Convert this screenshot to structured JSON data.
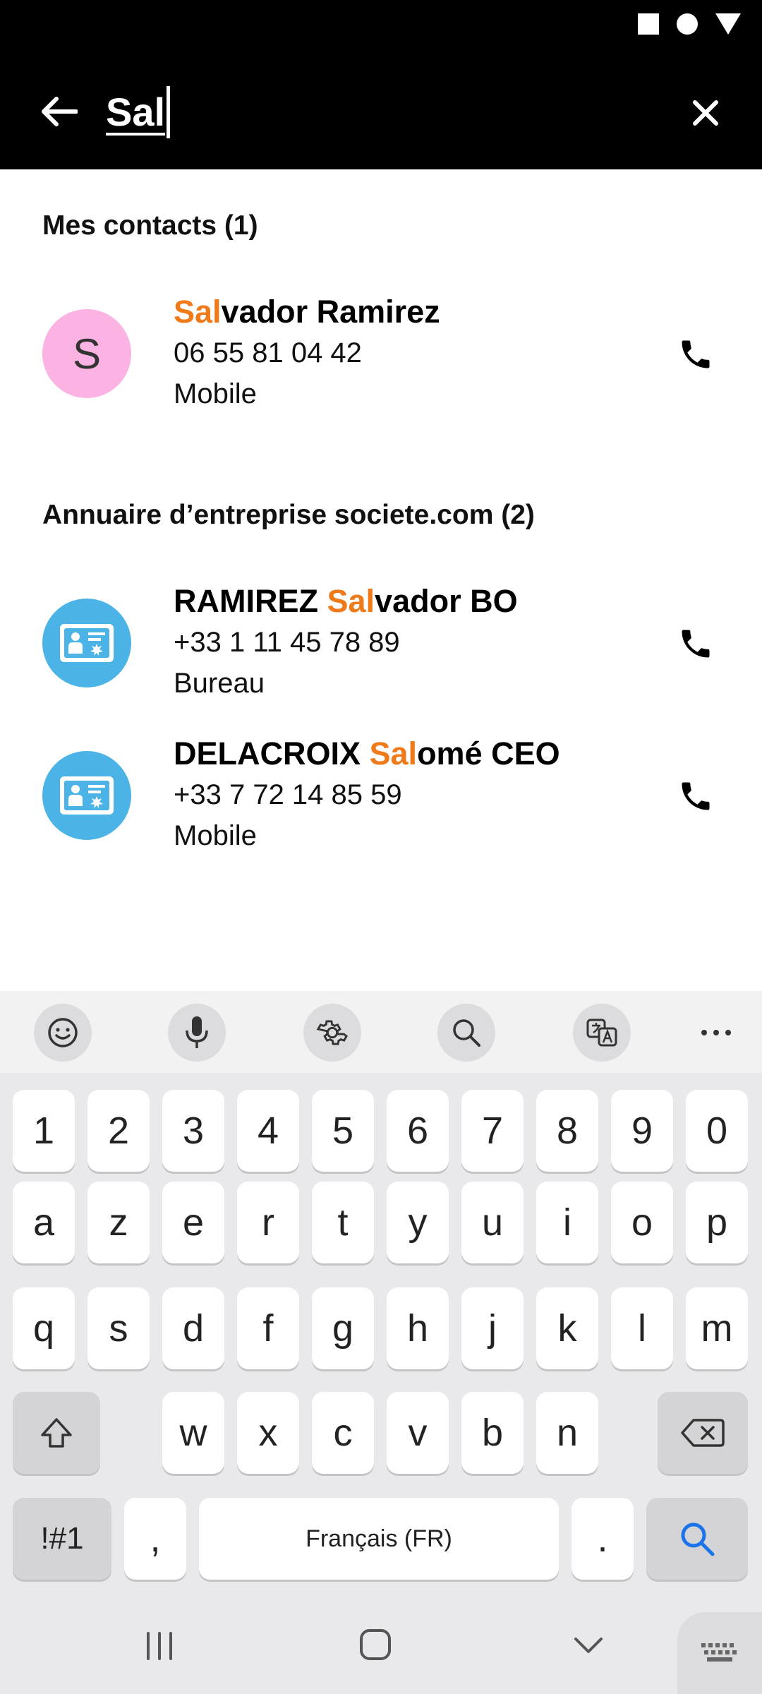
{
  "search": {
    "query": "Sal"
  },
  "sections": {
    "contacts_title": "Mes contacts (1)",
    "directory_title": "Annuaire d’entreprise societe.com (2)"
  },
  "contacts": [
    {
      "initial": "S",
      "name_before": "",
      "name_match": "Sal",
      "name_after": "vador Ramirez",
      "phone": "06 55 81 04 42",
      "type": "Mobile"
    }
  ],
  "directory": [
    {
      "name_before": "RAMIREZ ",
      "name_match": "Sal",
      "name_after": "vador BO",
      "phone": "+33 1 11 45 78 89",
      "type": "Bureau"
    },
    {
      "name_before": "DELACROIX ",
      "name_match": "Sal",
      "name_after": "omé CEO",
      "phone": "+33 7 72 14 85 59",
      "type": "Mobile"
    }
  ],
  "keyboard": {
    "toolbar_icons": [
      "emoji-icon",
      "microphone-icon",
      "settings-icon",
      "search-icon",
      "translate-icon",
      "more-icon"
    ],
    "row_numbers": [
      "1",
      "2",
      "3",
      "4",
      "5",
      "6",
      "7",
      "8",
      "9",
      "0"
    ],
    "row1": [
      "a",
      "z",
      "e",
      "r",
      "t",
      "y",
      "u",
      "i",
      "o",
      "p"
    ],
    "row2": [
      "q",
      "s",
      "d",
      "f",
      "g",
      "h",
      "j",
      "k",
      "l",
      "m"
    ],
    "row3": [
      "w",
      "x",
      "c",
      "v",
      "b",
      "n"
    ],
    "symbols_label": "!#1",
    "comma_label": ",",
    "space_label": "Français (FR)",
    "period_label": "."
  },
  "colors": {
    "highlight": "#ee7a1a",
    "company_avatar": "#4cb3e6",
    "contact_avatar": "#fbb3e3",
    "search_key": "#1a73e8"
  }
}
